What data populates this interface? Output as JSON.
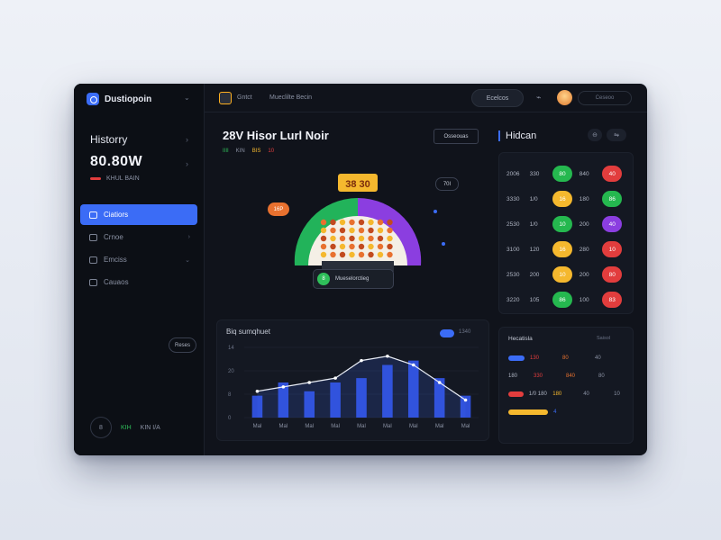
{
  "sidebar": {
    "brand": "Dustiopoin",
    "history_label": "Historry",
    "history_value": "80.80W",
    "history_sub": "KHUL BAIN",
    "nav": [
      {
        "label": "Ciatiors",
        "active": true
      },
      {
        "label": "Crnoe",
        "active": false
      },
      {
        "label": "Emciss",
        "active": false
      },
      {
        "label": "Cauaos",
        "active": false
      }
    ],
    "side_button": "Reses",
    "footer_circle": "8",
    "footer_green": "KIH",
    "footer_text": "KIN I/A"
  },
  "topbar": {
    "label1": "Gntct",
    "label2": "Mueclilte Becin",
    "button": "Ecelcos",
    "pill": "Ceseoo"
  },
  "game": {
    "title": "28V Hisor Lurl Noir",
    "tags": [
      {
        "text": "IIII",
        "color": "#2fbf5a"
      },
      {
        "text": "KIN",
        "color": "#8a91a3"
      },
      {
        "text": "BIS",
        "color": "#f5b82e"
      },
      {
        "text": "10",
        "color": "#e23d3d"
      }
    ],
    "button": "Osseouas",
    "wheel_top": "38 30",
    "tag_left": "16P",
    "tag_right": "70I",
    "footer_icon": "8",
    "footer_text": "Mueselorctieg"
  },
  "chart_panel": {
    "title": "Biq sumqhuet",
    "toggle_label": "1340",
    "y_ticks": [
      "14",
      "20",
      "8",
      "0"
    ],
    "x_ticks": [
      "Mal",
      "Mal",
      "Mal",
      "Mal",
      "Mal",
      "Mal",
      "Mal",
      "Mal",
      "Mal"
    ]
  },
  "chart_data": {
    "type": "bar",
    "categories": [
      "Mal",
      "Mal",
      "Mal",
      "Mal",
      "Mal",
      "Mal",
      "Mal",
      "Mal",
      "Mal"
    ],
    "values": [
      5,
      8,
      6,
      8,
      9,
      12,
      13,
      9,
      5
    ],
    "line": [
      6,
      7,
      8,
      9,
      13,
      14,
      12,
      8,
      4
    ],
    "ylim": [
      0,
      16
    ],
    "colors": {
      "bar": "#2f4fd8",
      "line": "#e8ecf5"
    }
  },
  "right": {
    "title": "Hidcan",
    "ctrl1": "⊖",
    "ctrl2": "⇋",
    "grid": [
      {
        "a": "2006",
        "b": "330",
        "c": "80",
        "c_color": "#25b84f",
        "d": "840",
        "e": "40",
        "e_color": "#e23d3d"
      },
      {
        "a": "3330",
        "b": "1/0",
        "c": "16",
        "c_color": "#f5b82e",
        "d": "180",
        "e": "86",
        "e_color": "#25b84f"
      },
      {
        "a": "2530",
        "b": "1/0",
        "c": "10",
        "c_color": "#25b84f",
        "d": "200",
        "e": "40",
        "e_color": "#8b3ee0"
      },
      {
        "a": "3100",
        "b": "120",
        "c": "16",
        "c_color": "#f5b82e",
        "d": "280",
        "e": "10",
        "e_color": "#e23d3d"
      },
      {
        "a": "2530",
        "b": "200",
        "c": "10",
        "c_color": "#f5b82e",
        "d": "200",
        "e": "80",
        "e_color": "#e23d3d"
      },
      {
        "a": "3220",
        "b": "105",
        "c": "86",
        "c_color": "#25b84f",
        "d": "100",
        "e": "83",
        "e_color": "#e23d3d"
      }
    ],
    "list_title": "Hecatisla",
    "list_filter": "Saisol",
    "list": [
      {
        "left": "",
        "left_bar": "#3b6cf6",
        "mid": "130",
        "mid_color": "#e23d3d",
        "right": "80",
        "right_color": "#e8712f",
        "far": "40"
      },
      {
        "left": "180",
        "left_bar": "",
        "mid": "330",
        "mid_color": "#e23d3d",
        "right": "840",
        "right_color": "#e8712f",
        "far": "80"
      },
      {
        "left": "1/0 180",
        "left_bar": "#e23d3d",
        "mid": "180",
        "mid_color": "#f5b82e",
        "right": "40",
        "right_color": "#8a91a3",
        "far": "10"
      },
      {
        "left": "",
        "left_bar": "#f5b82e",
        "mid": "4",
        "mid_color": "#3b6cf6",
        "right": "",
        "right_color": "#8a91a3",
        "far": ""
      }
    ]
  }
}
